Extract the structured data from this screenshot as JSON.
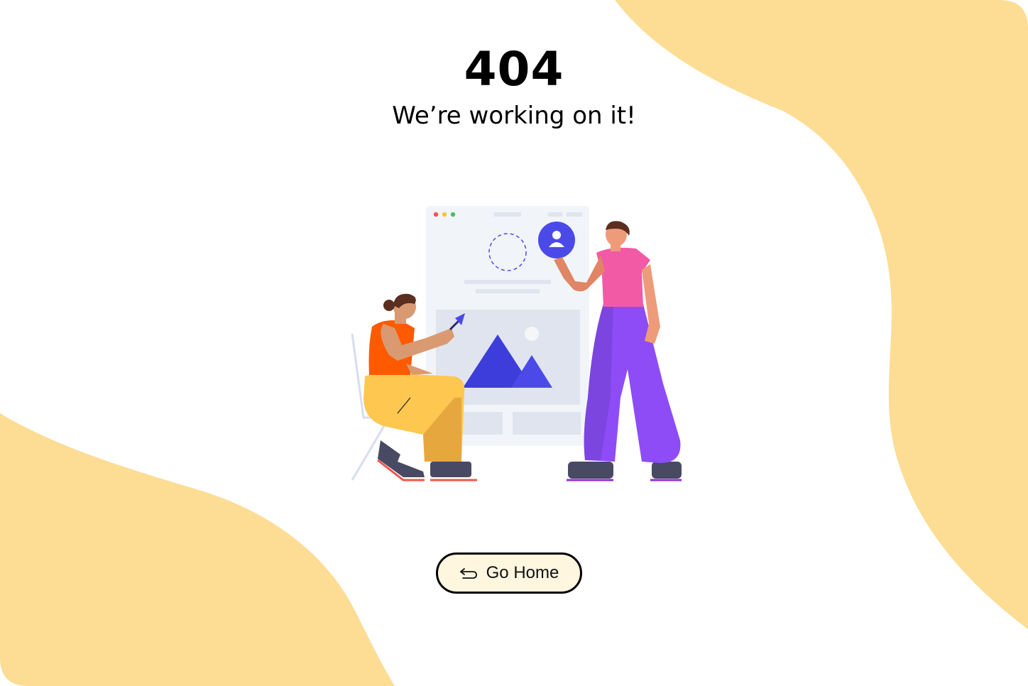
{
  "error": {
    "code": "404",
    "message": "We’re working on it!"
  },
  "action": {
    "go_home_label": "Go Home",
    "go_home_icon": "return-arrow-icon"
  },
  "colors": {
    "background": "#ffffff",
    "blob": "#fddc94",
    "button_fill": "#fff6df",
    "button_border": "#000000",
    "accent_blue": "#4b4ae8",
    "accent_pink": "#f25aa6",
    "accent_purple": "#8e4cf6",
    "accent_orange": "#ff5a00",
    "accent_yellow": "#fdc750"
  },
  "illustration": {
    "name": "people-designing-webpage-illustration"
  }
}
